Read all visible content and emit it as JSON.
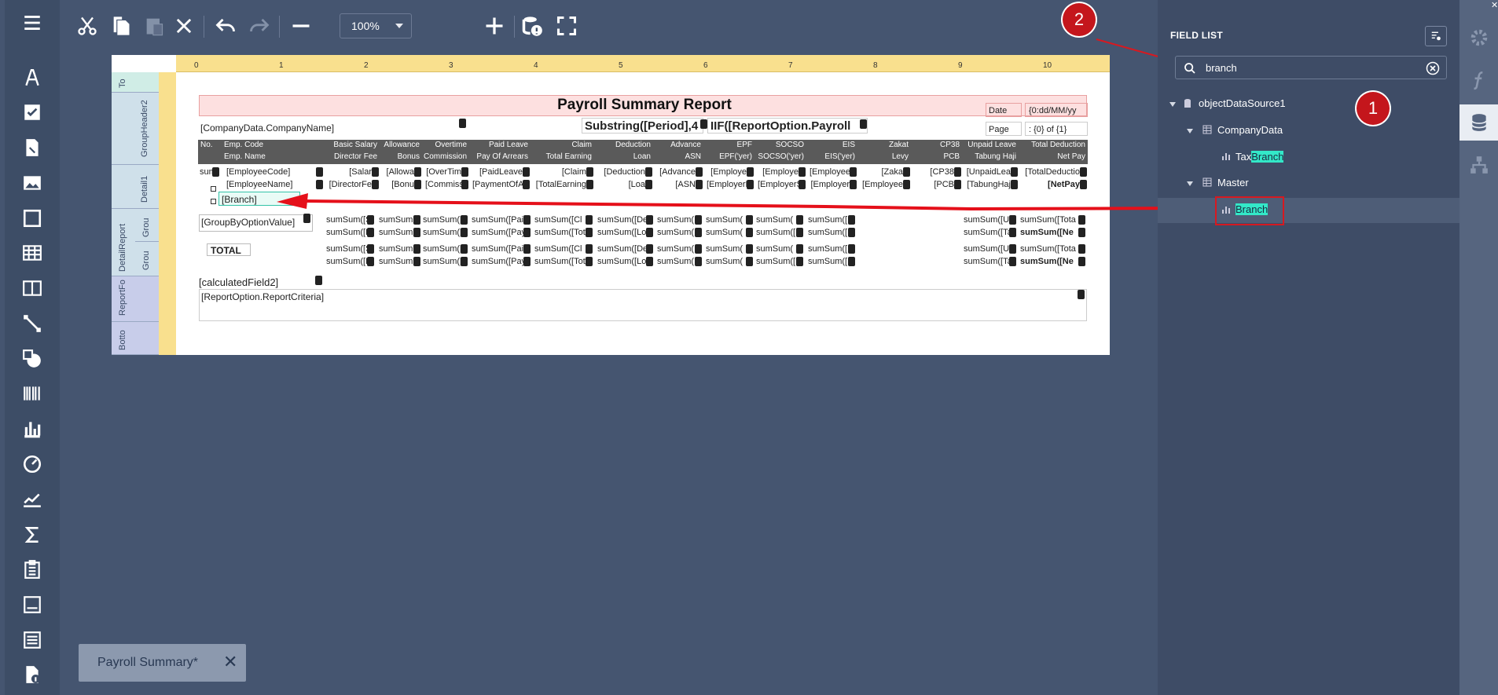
{
  "toolbar": {
    "zoom_value": "100%"
  },
  "report": {
    "title": "Payroll Summary Report",
    "company_field": "[CompanyData.CompanyName]",
    "period_expr": "Substring([Period],4",
    "option_expr": "IIF([ReportOption.Payroll",
    "date_label": "Date",
    "date_value": "{0:dd/MM/yy",
    "page_label": "Page",
    "page_value": ": {0} of {1}",
    "bands": [
      "To",
      "GroupHeader2",
      "Detail1",
      "DetailReport",
      "Grou",
      "Grou",
      "ReportFo",
      "Botto"
    ],
    "header_row1": [
      "No.",
      "Emp. Code",
      "Basic Salary",
      "Allowance",
      "Overtime",
      "Paid Leave",
      "Claim",
      "Deduction",
      "Advance",
      "EPF",
      "SOCSO",
      "EIS",
      "Zakat",
      "CP38",
      "Unpaid Leave",
      "Total Deduction"
    ],
    "header_row2": [
      "",
      "Emp. Name",
      "Director Fee",
      "Bonus",
      "Commission",
      "Pay Of Arrears",
      "Total Earning",
      "Loan",
      "ASN",
      "EPF('yer)",
      "SOCSO('yer)",
      "EIS('yer)",
      "Levy",
      "PCB",
      "Tabung Haji",
      "Net Pay"
    ],
    "detail_row1": [
      "sum",
      "[EmployeeCode]",
      "[Salar",
      "[Allowa",
      "[OverTim",
      "[PaidLeave",
      "[Claim",
      "[Deduction",
      "[Advance",
      "[Employe",
      "[Employe",
      "[Employee",
      "[Zaka",
      "[CP38",
      "[UnpaidLea",
      "[TotalDeductio"
    ],
    "detail_row2": [
      "",
      "[EmployeeName]",
      "[DirectorFe",
      "[Bonu",
      "[Commiss",
      "[PaymentOfAr",
      "[TotalEarning",
      "[Loa",
      "[ASN",
      "[EmployerE",
      "[EmployerS",
      "[Employer",
      "[Employee",
      "[PCB",
      "[TabungHaj",
      "[NetPay"
    ],
    "branch_field": "[Branch]",
    "group_field": "[GroupByOptionValue]",
    "sum_row1": [
      "sumSum([S",
      "sumSum([",
      "sumSum([",
      "sumSum([Paid",
      "sumSum([Cl",
      "sumSum([De",
      "sumSum(",
      "sumSum(",
      "sumSum(",
      "sumSum([",
      "sumSum([U",
      "sumSum([Tota"
    ],
    "sum_row2": [
      "sumSum([D",
      "sumSum([",
      "sumSum([",
      "sumSum([Pay",
      "sumSum([Tot",
      "sumSum([Lo",
      "sumSum(",
      "sumSum(",
      "sumSum([E",
      "sumSum([",
      "sumSum([Ta",
      "sumSum([Ne"
    ],
    "total_label": "TOTAL",
    "calc_field": "[calculatedField2]",
    "criteria_field": "[ReportOption.ReportCriteria]",
    "ruler_ticks": [
      "0",
      "1",
      "2",
      "3",
      "4",
      "5",
      "6",
      "7",
      "8",
      "9",
      "10"
    ]
  },
  "tab": {
    "label": "Payroll Summary*",
    "close": "✕"
  },
  "field_list": {
    "title": "FIELD LIST",
    "search_value": "branch",
    "tree": {
      "root": "objectDataSource1",
      "company": "CompanyData",
      "tax_prefix": "Tax",
      "tax_highlight": "Branch",
      "master": "Master",
      "branch": "Branch"
    }
  },
  "annotations": {
    "badge1": "1",
    "badge2": "2"
  },
  "colors": {
    "accent_red": "#c4161c",
    "highlight": "#33e8c8",
    "ruler": "#f9e08e"
  }
}
